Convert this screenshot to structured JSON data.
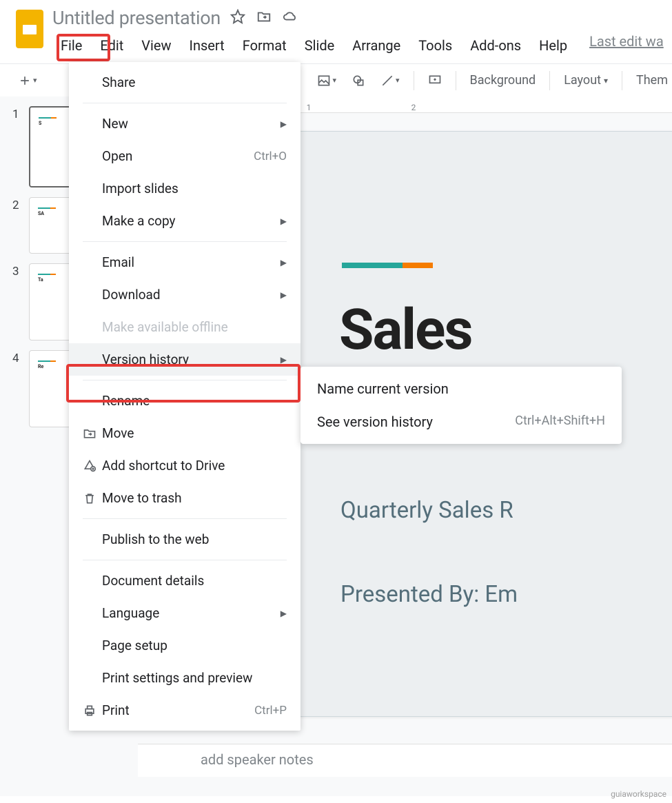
{
  "header": {
    "doc_title": "Untitled presentation",
    "last_edit": "Last edit wa"
  },
  "menubar": [
    "File",
    "Edit",
    "View",
    "Insert",
    "Format",
    "Slide",
    "Arrange",
    "Tools",
    "Add-ons",
    "Help"
  ],
  "toolbar": {
    "background": "Background",
    "layout": "Layout",
    "theme": "Them"
  },
  "ruler": [
    "1",
    "2"
  ],
  "thumbnails": [
    {
      "num": "1",
      "mini": "S"
    },
    {
      "num": "2",
      "mini": "SA"
    },
    {
      "num": "3",
      "mini": "Ta"
    },
    {
      "num": "4",
      "mini": "Re"
    }
  ],
  "slide": {
    "title": "Sales",
    "sub1": "Quarterly Sales R",
    "sub2": "Presented By: Em"
  },
  "speaker_notes_placeholder": "add speaker notes",
  "file_menu": {
    "share": "Share",
    "new": "New",
    "open": "Open",
    "open_shortcut": "Ctrl+O",
    "import_slides": "Import slides",
    "make_copy": "Make a copy",
    "email": "Email",
    "download": "Download",
    "make_offline": "Make available offline",
    "version_history": "Version history",
    "rename": "Rename",
    "move": "Move",
    "add_shortcut": "Add shortcut to Drive",
    "move_trash": "Move to trash",
    "publish": "Publish to the web",
    "document_details": "Document details",
    "language": "Language",
    "page_setup": "Page setup",
    "print_settings": "Print settings and preview",
    "print": "Print",
    "print_shortcut": "Ctrl+P"
  },
  "submenu": {
    "name_current": "Name current version",
    "see_history": "See version history",
    "see_shortcut": "Ctrl+Alt+Shift+H"
  },
  "watermark": "guiaworkspace"
}
